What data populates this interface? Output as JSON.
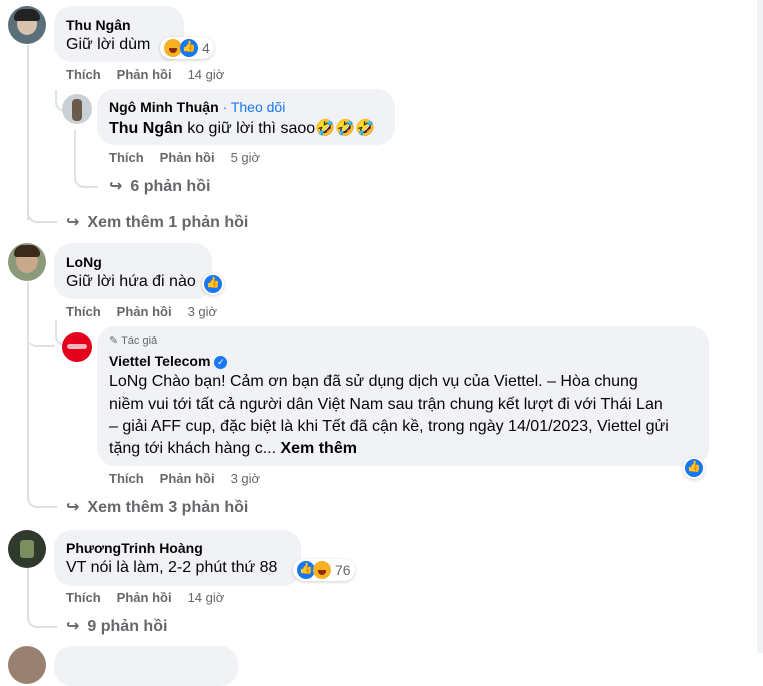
{
  "comments": [
    {
      "author": "Thu Ngân",
      "text": "Giữ lời dùm",
      "reactions": {
        "count": "4"
      },
      "actions": {
        "like": "Thích",
        "reply": "Phản hồi",
        "time": "14 giờ"
      },
      "reply": {
        "author": "Ngô Minh Thuận",
        "follow": "· Theo dõi",
        "mention": "Thu Ngân",
        "text": " ko giữ lời thì saoo🤣🤣🤣",
        "actions": {
          "like": "Thích",
          "reply": "Phản hồi",
          "time": "5 giờ"
        },
        "more": "6 phản hồi"
      },
      "see_more": "Xem thêm 1 phản hồi"
    },
    {
      "author": "LoNg",
      "text": "Giữ lời hứa đi nào",
      "actions": {
        "like": "Thích",
        "reply": "Phản hồi",
        "time": "3 giờ"
      },
      "reply": {
        "badge": "Tác giả",
        "author": "Viettel Telecom",
        "lines": [
          "LoNg Chào bạn! Cảm ơn bạn đã sử dụng dịch vụ của Viettel. – Hòa chung",
          "niềm vui tới tất cả người dân Việt Nam sau trận chung kết lượt đi với Thái Lan",
          "– giải AFF cup, đặc biệt là khi Tết đã cận kề, trong ngày 14/01/2023, Viettel gửi",
          "tặng tới khách hàng c... "
        ],
        "see_more": "Xem thêm",
        "actions": {
          "like": "Thích",
          "reply": "Phản hồi",
          "time": "3 giờ"
        }
      },
      "see_more": "Xem thêm 3 phản hồi"
    },
    {
      "author": "PhươngTrinh Hoàng",
      "text": "VT nói là làm, 2-2 phút thứ 88",
      "reactions": {
        "count": "76"
      },
      "actions": {
        "like": "Thích",
        "reply": "Phản hồi",
        "time": "14 giờ"
      },
      "more": "9 phản hồi"
    }
  ]
}
